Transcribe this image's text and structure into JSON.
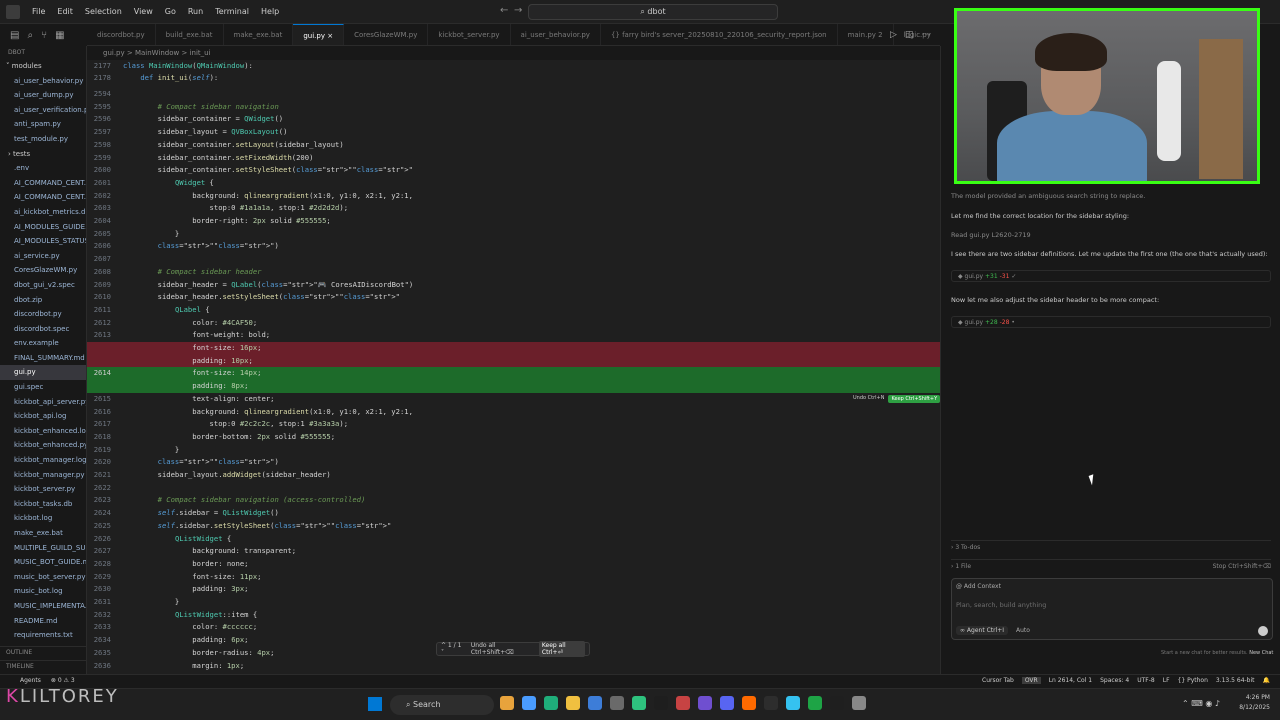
{
  "titlebar": {
    "menus": [
      "File",
      "Edit",
      "Selection",
      "View",
      "Go",
      "Run",
      "Terminal",
      "Help"
    ],
    "search": "dbot"
  },
  "explorer": {
    "header": "DBOT",
    "items": [
      {
        "label": "ai_user_behavior.py",
        "folder": false
      },
      {
        "label": "ai_user_dump.py",
        "folder": false
      },
      {
        "label": "ai_user_verification.py",
        "folder": false
      },
      {
        "label": "anti_spam.py",
        "folder": false
      },
      {
        "label": "test_module.py",
        "folder": false
      },
      {
        "label": "tests",
        "folder": true
      },
      {
        "label": ".env",
        "folder": false
      },
      {
        "label": "AI_COMMAND_CENT...",
        "folder": false
      },
      {
        "label": "AI_COMMAND_CENT...",
        "folder": false
      },
      {
        "label": "ai_kickbot_metrics.db",
        "folder": false
      },
      {
        "label": "AI_MODULES_GUIDE...",
        "folder": false
      },
      {
        "label": "AI_MODULES_STATUS...",
        "folder": false
      },
      {
        "label": "ai_service.py",
        "folder": false
      },
      {
        "label": "CoresGlazeWM.py",
        "folder": false
      },
      {
        "label": "dbot_gui_v2.spec",
        "folder": false
      },
      {
        "label": "dbot.zip",
        "folder": false
      },
      {
        "label": "discordbot.py",
        "folder": false
      },
      {
        "label": "discordbot.spec",
        "folder": false
      },
      {
        "label": "env.example",
        "folder": false
      },
      {
        "label": "FINAL_SUMMARY.md",
        "folder": false
      },
      {
        "label": "gui.py",
        "folder": false,
        "active": true
      },
      {
        "label": "gui.spec",
        "folder": false
      },
      {
        "label": "kickbot_api_server.py",
        "folder": false
      },
      {
        "label": "kickbot_api.log",
        "folder": false
      },
      {
        "label": "kickbot_enhanced.log",
        "folder": false
      },
      {
        "label": "kickbot_enhanced.py",
        "folder": false
      },
      {
        "label": "kickbot_manager.log",
        "folder": false
      },
      {
        "label": "kickbot_manager.py",
        "folder": false
      },
      {
        "label": "kickbot_server.py",
        "folder": false
      },
      {
        "label": "kickbot_tasks.db",
        "folder": false
      },
      {
        "label": "kickbot.log",
        "folder": false
      },
      {
        "label": "make_exe.bat",
        "folder": false
      },
      {
        "label": "MULTIPLE_GUILD_SU...",
        "folder": false
      },
      {
        "label": "MUSIC_BOT_GUIDE.md",
        "folder": false
      },
      {
        "label": "music_bot_server.py",
        "folder": false
      },
      {
        "label": "music_bot.log",
        "folder": false
      },
      {
        "label": "MUSIC_IMPLEMENTA...",
        "folder": false
      },
      {
        "label": "README.md",
        "folder": false
      },
      {
        "label": "requirements.txt",
        "folder": false
      }
    ],
    "modules_label": "modules",
    "outline": "OUTLINE",
    "timeline": "TIMELINE"
  },
  "tabs": [
    {
      "label": "discordbot.py",
      "active": false
    },
    {
      "label": "build_exe.bat",
      "active": false
    },
    {
      "label": "make_exe.bat",
      "active": false
    },
    {
      "label": "gui.py",
      "active": true
    },
    {
      "label": "CoresGlazeWM.py",
      "active": false
    },
    {
      "label": "kickbot_server.py",
      "active": false
    },
    {
      "label": "ai_user_behavior.py",
      "active": false
    },
    {
      "label": "{} farry bird's server_20250810_220106_security_report.json",
      "active": false
    },
    {
      "label": "main.py 2",
      "active": false
    },
    {
      "label": "logic.py",
      "active": false
    }
  ],
  "breadcrumb": "gui.py > MainWindow > init_ui",
  "editor": {
    "sticky": [
      {
        "num": "2177",
        "code": "class MainWindow(QMainWindow):"
      },
      {
        "num": "2178",
        "code": "    def init_ui(self):"
      }
    ],
    "lines": [
      {
        "num": "2594",
        "code": ""
      },
      {
        "num": "2595",
        "code": "        # Compact sidebar navigation"
      },
      {
        "num": "2596",
        "code": "        sidebar_container = QWidget()"
      },
      {
        "num": "2597",
        "code": "        sidebar_layout = QVBoxLayout()"
      },
      {
        "num": "2598",
        "code": "        sidebar_container.setLayout(sidebar_layout)"
      },
      {
        "num": "2599",
        "code": "        sidebar_container.setFixedWidth(200)"
      },
      {
        "num": "2600",
        "code": "        sidebar_container.setStyleSheet(\"\"\""
      },
      {
        "num": "2601",
        "code": "            QWidget {"
      },
      {
        "num": "2602",
        "code": "                background: qlineargradient(x1:0, y1:0, x2:1, y2:1,"
      },
      {
        "num": "2603",
        "code": "                    stop:0 #1a1a1a, stop:1 #2d2d2d);"
      },
      {
        "num": "2604",
        "code": "                border-right: 2px solid #555555;"
      },
      {
        "num": "2605",
        "code": "            }"
      },
      {
        "num": "2606",
        "code": "        \"\"\")"
      },
      {
        "num": "2607",
        "code": ""
      },
      {
        "num": "2608",
        "code": "        # Compact sidebar header"
      },
      {
        "num": "2609",
        "code": "        sidebar_header = QLabel(\"🎮 CoresAIDiscordBot\")"
      },
      {
        "num": "2610",
        "code": "        sidebar_header.setStyleSheet(\"\"\""
      },
      {
        "num": "2611",
        "code": "            QLabel {"
      },
      {
        "num": "2612",
        "code": "                color: #4CAF50;"
      },
      {
        "num": "2613",
        "code": "                font-weight: bold;"
      },
      {
        "num": "",
        "code": "                font-size: 16px;",
        "type": "del"
      },
      {
        "num": "",
        "code": "                padding: 10px;",
        "type": "del"
      },
      {
        "num": "2614",
        "code": "                font-size: 14px;",
        "type": "add"
      },
      {
        "num": "",
        "code": "                padding: 8px;",
        "type": "add"
      },
      {
        "num": "2615",
        "code": "                text-align: center;"
      },
      {
        "num": "2616",
        "code": "                background: qlineargradient(x1:0, y1:0, x2:1, y2:1,"
      },
      {
        "num": "2617",
        "code": "                    stop:0 #2c2c2c, stop:1 #3a3a3a);"
      },
      {
        "num": "2618",
        "code": "                border-bottom: 2px solid #555555;"
      },
      {
        "num": "2619",
        "code": "            }"
      },
      {
        "num": "2620",
        "code": "        \"\"\")"
      },
      {
        "num": "2621",
        "code": "        sidebar_layout.addWidget(sidebar_header)"
      },
      {
        "num": "2622",
        "code": ""
      },
      {
        "num": "2623",
        "code": "        # Compact sidebar navigation (access-controlled)"
      },
      {
        "num": "2624",
        "code": "        self.sidebar = QListWidget()"
      },
      {
        "num": "2625",
        "code": "        self.sidebar.setStyleSheet(\"\"\""
      },
      {
        "num": "2626",
        "code": "            QListWidget {"
      },
      {
        "num": "2627",
        "code": "                background: transparent;"
      },
      {
        "num": "2628",
        "code": "                border: none;"
      },
      {
        "num": "2629",
        "code": "                font-size: 11px;"
      },
      {
        "num": "2630",
        "code": "                padding: 3px;"
      },
      {
        "num": "2631",
        "code": "            }"
      },
      {
        "num": "2632",
        "code": "            QListWidget::item {"
      },
      {
        "num": "2633",
        "code": "                color: #cccccc;"
      },
      {
        "num": "2634",
        "code": "                padding: 6px;"
      },
      {
        "num": "2635",
        "code": "                border-radius: 4px;"
      },
      {
        "num": "2636",
        "code": "                margin: 1px;"
      }
    ],
    "inline_undo": "Undo Ctrl+N",
    "inline_keep": "Keep Ctrl+Shift+Y",
    "diff_nav": "^ 1 / 1 ˅",
    "undo_all": "Undo all Ctrl+Shift+⌫",
    "keep_all": "Keep all Ctrl+⏎"
  },
  "chat": {
    "messages": [
      {
        "text": "The model provided an ambiguous search string to replace.",
        "dim": true
      },
      {
        "text": "Let me find the correct location for the sidebar styling:",
        "dim": false
      },
      {
        "text": "Read gui.py L2620-2719",
        "dim": true
      },
      {
        "text": "I see there are two sidebar definitions. Let me update the first one (the one that's actually used):",
        "dim": false
      }
    ],
    "edit1": {
      "file": "gui.py",
      "plus": "+31",
      "minus": "-31"
    },
    "msg_after": "Now let me also adjust the sidebar header to be more compact:",
    "edit2": {
      "file": "gui.py",
      "plus": "+28",
      "minus": "-28"
    },
    "todos": "3 To-dos",
    "files": "1 File",
    "stop": "Stop Ctrl+Shift+⌫",
    "add_context": "@ Add Context",
    "placeholder": "Plan, search, build anything",
    "agent": "∞ Agent Ctrl+I",
    "auto": "Auto",
    "footer": "Start a new chat for better results.",
    "new_chat": "New Chat"
  },
  "statusbar": {
    "left": [
      "Agents",
      "⊗ 0 ⚠ 3"
    ],
    "right": [
      "Cursor Tab",
      "OVR",
      "Ln 2614, Col 1",
      "Spaces: 4",
      "UTF-8",
      "LF",
      "{} Python",
      "3.13.5 64-bit",
      "🔔"
    ]
  },
  "taskbar": {
    "search": "Search",
    "time": "4:26 PM",
    "date": "8/12/2025",
    "app_colors": [
      "#e8a33c",
      "#4a9cff",
      "#1fae7a",
      "#f0c040",
      "#3d7dd8",
      "#6a6a6a",
      "#2ec27e",
      "#1e1e1e",
      "#c74343",
      "#6f4fd0",
      "#5865f2",
      "#ff6a00",
      "#2d2d2d",
      "#35c2f0",
      "#1ea446",
      "#1f1f1f",
      "#888888"
    ]
  },
  "overlay": "LILTOREY"
}
